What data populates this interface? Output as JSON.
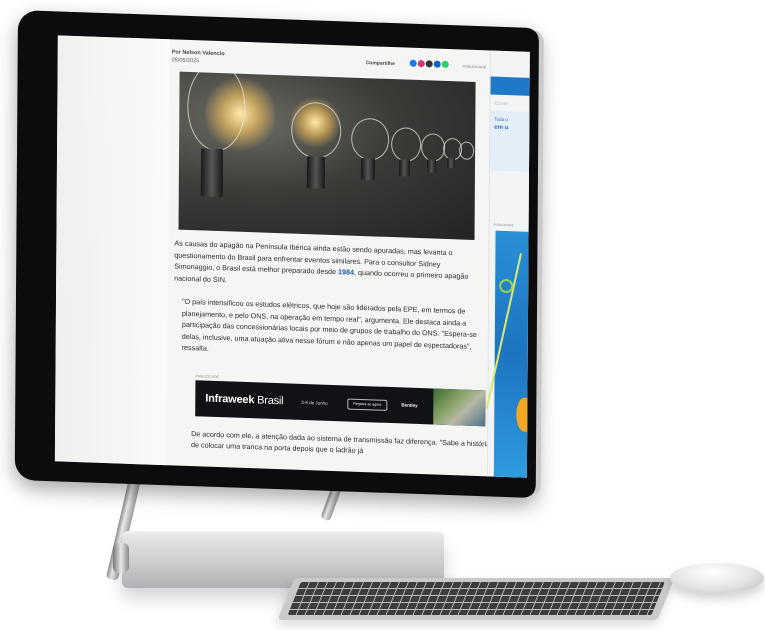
{
  "article": {
    "author": "Por Nelson Valencio",
    "date": "05/05/2025",
    "share_label": "Compartilhe",
    "publicidade": "PUBLICIDADE",
    "paragraph1_before_link": "As causas do apagão na Península Ibérica ainda estão sendo apuradas, mas levanta o questionamento do Brasil para enfrentar eventos similares. Para o consultor Sidney Simonaggio, o Brasil está melhor preparado desde ",
    "paragraph1_link": "1984",
    "paragraph1_after_link": ", quando ocorreu o primeiro apagão nacional do SIN.",
    "quote": "\"O país intensificou os estudos elétricos, que hoje são liderados pela EPE, em termos de planejamento, e pelo ONS, na operação em tempo real\", argumenta. Ele destaca ainda a participação das concessionárias locais por meio de grupos de trabalho do ONS. \"Espera-se delas, inclusive, uma atuação ativa nesse fórum e não apenas um papel de espectadoras\", ressalta.",
    "after_ad": "De acordo com ele, a atenção dada ao sistema de transmissão faz diferença. \"Sabe a história de colocar uma tranca na porta depois que o ladrão já"
  },
  "ad": {
    "label": "PUBLICIDADE",
    "brand_bold": "Infraweek",
    "brand_light": " Brasil",
    "date": "3-6 de Junho",
    "button": "Registre-se agora",
    "sponsor": "Bentley"
  },
  "sidebar": {
    "search_placeholder": "Conte",
    "card_line1": "Todo o",
    "card_line2": "em u",
    "pub_label": "PUBLICIDADE"
  },
  "share_icons": [
    "facebook-icon",
    "instagram-icon",
    "x-icon",
    "linkedin-icon",
    "whatsapp-icon"
  ],
  "colors": {
    "link": "#1b5cae",
    "facebook": "#1877f2",
    "instagram": "#d6336c",
    "x": "#333333",
    "linkedin": "#0a66c2",
    "whatsapp": "#25d366",
    "sidebar_accent": "#1f78c8"
  }
}
